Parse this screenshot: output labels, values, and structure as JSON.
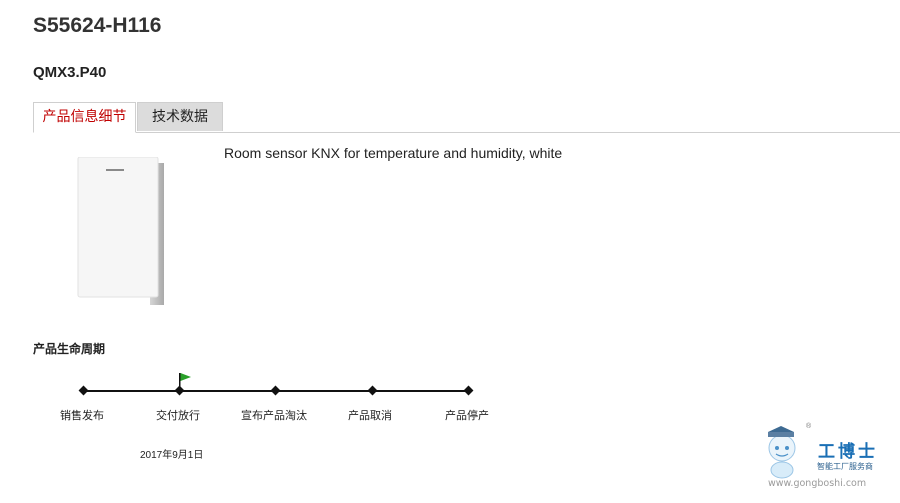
{
  "header": {
    "title": "S55624-H116",
    "model": "QMX3.P40"
  },
  "tabs": [
    {
      "label": "产品信息细节",
      "active": true
    },
    {
      "label": "技术数据",
      "active": false
    }
  ],
  "product": {
    "description": "Room sensor KNX for temperature and humidity, white",
    "image_icon": "product-image"
  },
  "lifecycle": {
    "title": "产品生命周期",
    "stages": [
      {
        "label": "销售发布"
      },
      {
        "label": "交付放行"
      },
      {
        "label": "宣布产品淘汰"
      },
      {
        "label": "产品取消"
      },
      {
        "label": "产品停产"
      }
    ],
    "current_stage_flag_color": "#2aa12a",
    "date": "2017年9月1日"
  },
  "watermark": {
    "brand": "工博士",
    "tagline": "智能工厂服务商",
    "url": "www.gongboshi.com",
    "reg": "®"
  }
}
